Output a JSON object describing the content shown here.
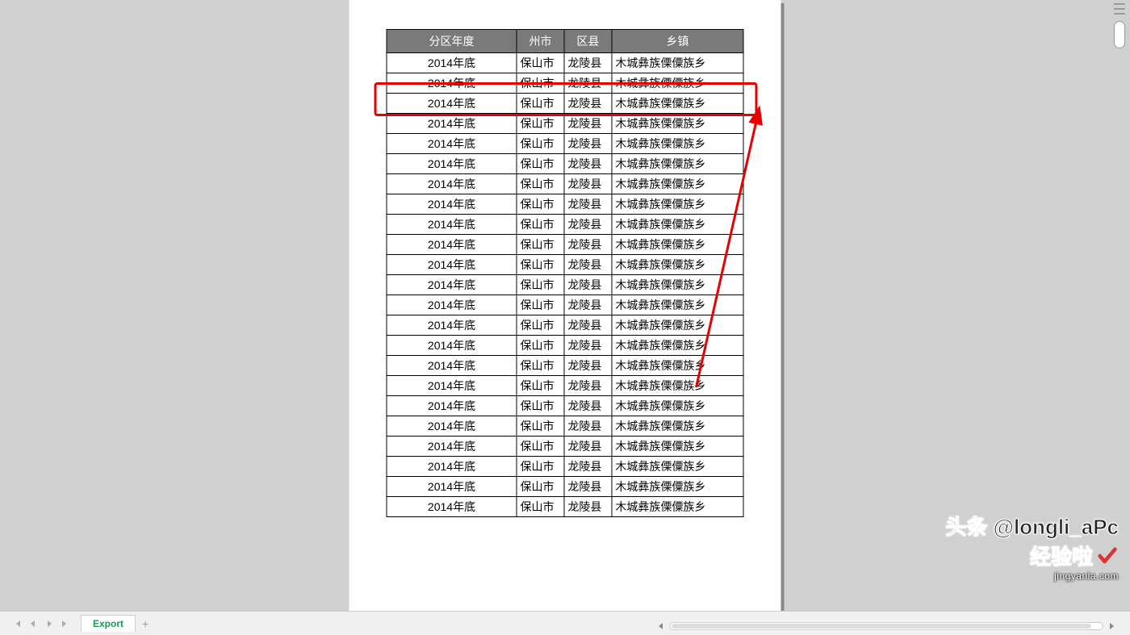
{
  "table": {
    "headers": [
      "分区年度",
      "州市",
      "区县",
      "乡镇"
    ],
    "row": {
      "year": "2014年底",
      "city": "保山市",
      "county": "龙陵县",
      "town": "木城彝族傈僳族乡"
    },
    "row_count": 23
  },
  "bottom_bar": {
    "sheet_tab": "Export",
    "nav": {
      "first": "⏮",
      "prev": "◀",
      "next": "▶",
      "last": "⏭"
    },
    "add": "+"
  },
  "watermark": {
    "line1": "头条 @longli_aPc",
    "line2": "经验啦",
    "url": "jingyanla.com"
  },
  "annotations": {
    "highlight_color": "#e60000"
  }
}
